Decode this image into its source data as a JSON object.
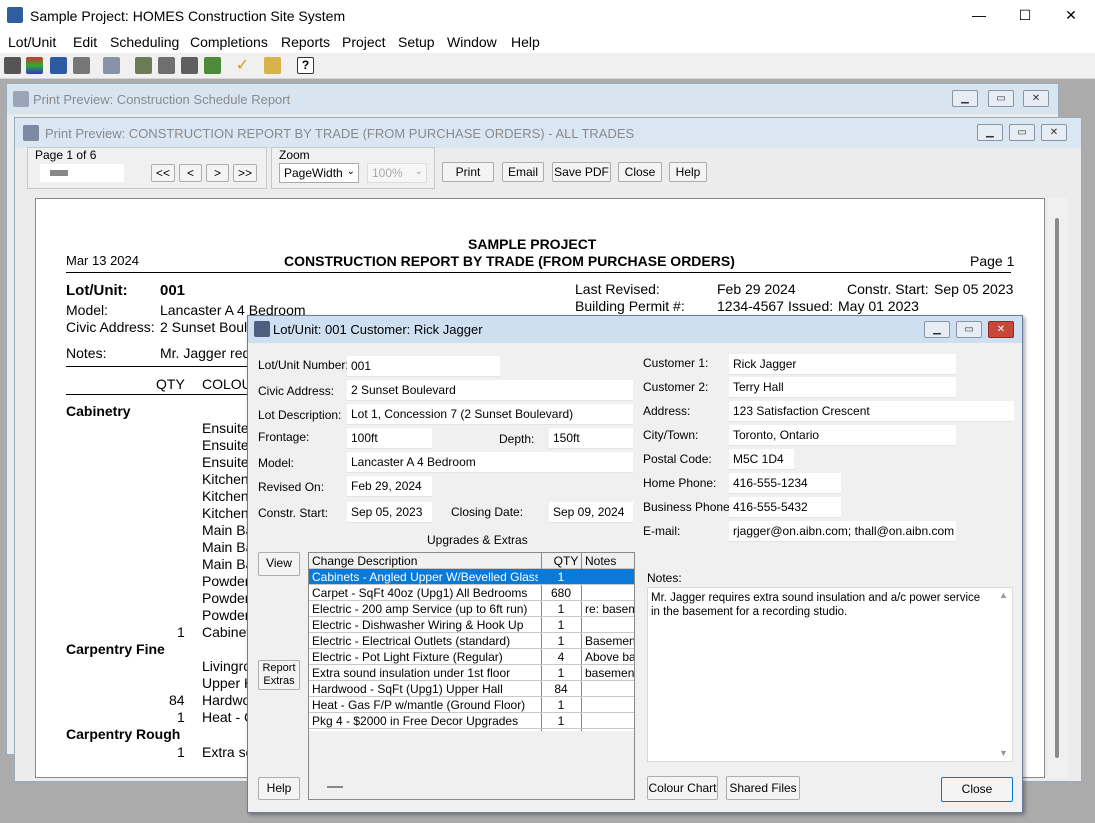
{
  "app": {
    "title": "Sample Project: HOMES Construction Site System",
    "colors": {
      "accent": "#0078d7",
      "selected_row": "#0a7ad8",
      "close_x": "#c42b1c"
    }
  },
  "window_controls": {
    "minimize": "—",
    "maximize": "☐",
    "close": "✕"
  },
  "menu": [
    "Lot/Unit",
    "Edit",
    "Scheduling",
    "Completions",
    "Reports",
    "Project",
    "Setup",
    "Window",
    "Help"
  ],
  "toolbar_icons": [
    "tools-icon",
    "grid-icon",
    "home-icon",
    "print-icon",
    "copy-icon",
    "schedule-icon",
    "calendar-icon",
    "report-icon",
    "checklist-icon",
    "check-icon",
    "folder-open-icon",
    "help-icon"
  ],
  "preview1": {
    "title": "Print Preview: Construction Schedule Report"
  },
  "preview2": {
    "title": "Print Preview: CONSTRUCTION REPORT BY TRADE (FROM PURCHASE ORDERS) - ALL TRADES",
    "page_label": "Page 1 of 6",
    "zoom_label": "Zoom",
    "zoom_value": "PageWidth",
    "zoom_pct": "100%",
    "nav": [
      "<<",
      "<",
      ">",
      ">>"
    ],
    "buttons": {
      "print": "Print",
      "email": "Email",
      "save_pdf": "Save PDF",
      "close": "Close",
      "help": "Help"
    }
  },
  "report": {
    "date": "Mar 13 2024",
    "project": "SAMPLE PROJECT",
    "title": "CONSTRUCTION REPORT BY TRADE (FROM PURCHASE ORDERS)",
    "page": "Page 1",
    "lot_label": "Lot/Unit:",
    "lot_value": "001",
    "model_label": "Model:",
    "model_value": "Lancaster A 4 Bedroom",
    "civic_label": "Civic Address:",
    "civic_value": "2 Sunset Boule",
    "notes_label": "Notes:",
    "notes_value": "Mr. Jagger req",
    "last_revised_label": "Last Revised:",
    "last_revised_value": "Feb 29 2024",
    "constr_start_label": "Constr. Start:",
    "constr_start_value": "Sep 05 2023",
    "permit_label": "Building Permit #:",
    "permit_value": "1234-4567",
    "issued_label": "Issued:",
    "issued_value": "May 01 2023",
    "col_qty": "QTY",
    "col_colour": "COLOU",
    "sections": [
      {
        "name": "Cabinetry",
        "rows": [
          [
            "",
            "Ensuite"
          ],
          [
            "",
            "Ensuite"
          ],
          [
            "",
            "Ensuite"
          ],
          [
            "",
            "Kitchen"
          ],
          [
            "",
            "Kitchen"
          ],
          [
            "",
            "Kitchen"
          ],
          [
            "",
            "Main Ba"
          ],
          [
            "",
            "Main Ba"
          ],
          [
            "",
            "Main Ba"
          ],
          [
            "",
            "Powder"
          ],
          [
            "",
            "Powder"
          ],
          [
            "",
            "Powder"
          ],
          [
            "1",
            "Cabinet"
          ]
        ]
      },
      {
        "name": "Carpentry Fine",
        "rows": [
          [
            "",
            "Livingro"
          ],
          [
            "",
            "Upper H"
          ],
          [
            "84",
            "Hardwo"
          ],
          [
            "1",
            "Heat - C"
          ]
        ]
      },
      {
        "name": "Carpentry Rough",
        "rows": [
          [
            "1",
            "Extra so"
          ]
        ]
      }
    ]
  },
  "dialog": {
    "title": "Lot/Unit: 001   Customer: Rick Jagger",
    "fields": {
      "lot_number_label": "Lot/Unit Number:",
      "lot_number": "001",
      "civic_label": "Civic Address:",
      "civic": "2 Sunset Boulevard",
      "lot_desc_label": "Lot Description:",
      "lot_desc": "Lot 1, Concession 7 (2 Sunset Boulevard)",
      "frontage_label": "Frontage:",
      "frontage": "100ft",
      "depth_label": "Depth:",
      "depth": "150ft",
      "model_label": "Model:",
      "model": "Lancaster A 4 Bedroom",
      "revised_label": "Revised On:",
      "revised": "Feb 29, 2024",
      "constr_label": "Constr. Start:",
      "constr": "Sep 05, 2023",
      "closing_label": "Closing Date:",
      "closing": "Sep 09, 2024",
      "cust1_label": "Customer 1:",
      "cust1": "Rick Jagger",
      "cust2_label": "Customer 2:",
      "cust2": "Terry Hall",
      "address_label": "Address:",
      "address": "123 Satisfaction Crescent",
      "city_label": "City/Town:",
      "city": "Toronto, Ontario",
      "postal_label": "Postal Code:",
      "postal": "M5C 1D4",
      "home_phone_label": "Home Phone:",
      "home_phone": "416-555-1234",
      "biz_phone_label": "Business Phone:",
      "biz_phone": "416-555-5432",
      "email_label": "E-mail:",
      "email": "rjagger@on.aibn.com; thall@on.aibn.com"
    },
    "upgrades_title": "Upgrades & Extras",
    "upgrades_headers": [
      "Change Description",
      "QTY",
      "Notes"
    ],
    "upgrades": [
      [
        "Cabinets - Angled Upper W/Bevelled Glass",
        "1",
        ""
      ],
      [
        "Carpet - SqFt 40oz (Upg1) All Bedrooms",
        "680",
        ""
      ],
      [
        "Electric - 200 amp Service (up to 6ft run)",
        "1",
        "re: baseme"
      ],
      [
        "Electric - Dishwasher Wiring & Hook Up",
        "1",
        ""
      ],
      [
        "Electric - Electrical Outlets (standard)",
        "1",
        "Basement"
      ],
      [
        "Electric - Pot Light Fixture (Regular)",
        "4",
        "Above bas"
      ],
      [
        "Extra sound insulation under 1st floor",
        "1",
        "basement"
      ],
      [
        "Hardwood - SqFt (Upg1) Upper Hall",
        "84",
        ""
      ],
      [
        "Heat - Gas F/P w/mantle (Ground Floor)",
        "1",
        ""
      ],
      [
        "Pkg 4 - $2000 in Free Decor Upgrades",
        "1",
        ""
      ]
    ],
    "notes_label": "Notes:",
    "notes": "Mr. Jagger requires extra sound insulation and a/c power service in the basement for a recording studio.",
    "buttons": {
      "view": "View",
      "report_extras_1": "Report",
      "report_extras_2": "Extras",
      "help": "Help",
      "colour_chart": "Colour Chart",
      "shared_files": "Shared Files",
      "close": "Close"
    }
  }
}
